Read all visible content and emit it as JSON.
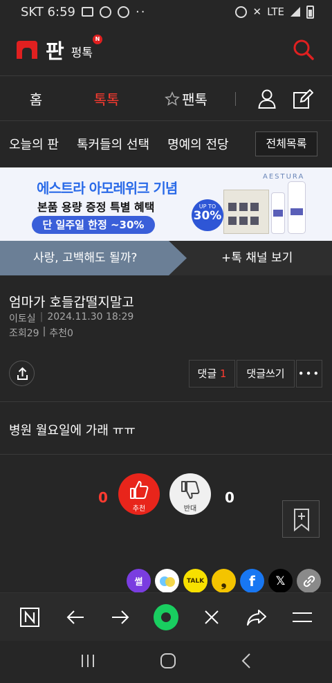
{
  "status_bar": {
    "carrier_time": "SKT 6:59",
    "dots": "··",
    "lte": "LTE"
  },
  "app_bar": {
    "logo_text": "판",
    "sub_label": "펑톡",
    "new_badge": "N"
  },
  "tabs": {
    "home": "홈",
    "toktok": "톡톡",
    "fantok": "팬톡"
  },
  "sub_nav": {
    "items": [
      "오늘의 판",
      "톡커들의 선택",
      "명예의 전당"
    ],
    "all_list": "전체목록"
  },
  "banner": {
    "line1": "에스트라 아모레위크 기념",
    "line2": "본품 용량 증정 특별 혜택",
    "line3": "단 일주일 한정 ~30%",
    "brand": "AESTURA",
    "badge_top": "UP TO",
    "badge_pct": "30%"
  },
  "channel": {
    "name": "사랑, 고백해도 될까?",
    "more": "+톡 채널 보기"
  },
  "post": {
    "title": "엄마가 호들갑떨지말고",
    "author": "이토실",
    "date": "2024.11.30 18:29",
    "views": "조회29",
    "recommend": "추천0",
    "body": "병원 월요일에 가래 ㅠㅠ"
  },
  "comments": {
    "label": "댓글",
    "count": "1",
    "write": "댓글쓰기",
    "more": "•••"
  },
  "vote": {
    "up_count": "0",
    "up_label": "추천",
    "down_count": "0",
    "down_label": "반대"
  },
  "share": {
    "ssul": "썰",
    "talk": "TALK",
    "story": "❟",
    "facebook": "f",
    "x": "𝕏"
  },
  "colors": {
    "accent": "#ff3b30",
    "background": "#262626",
    "channel_bg": "#6b7f96",
    "home_ball": "#19ce60"
  }
}
